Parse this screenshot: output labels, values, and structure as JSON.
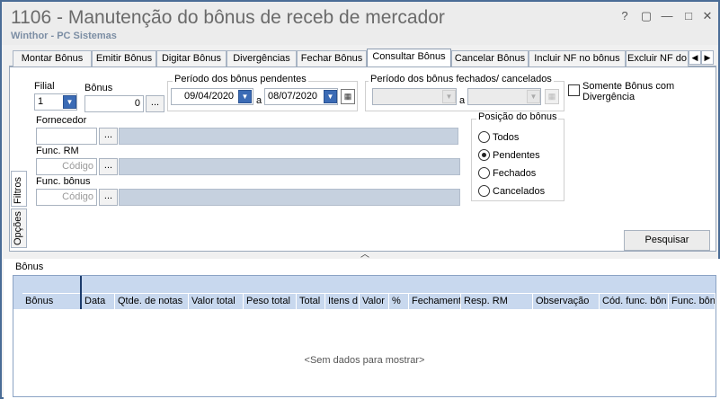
{
  "window": {
    "title": "1106 - Manutenção do bônus de receb de mercador",
    "subtitle": "Winthor - PC Sistemas",
    "controls": {
      "help": "?",
      "restore": "▢",
      "minimize": "—",
      "maximize": "□",
      "close": "✕"
    }
  },
  "tabs": [
    {
      "label": "Montar Bônus"
    },
    {
      "label": "Emitir Bônus"
    },
    {
      "label": "Digitar Bônus"
    },
    {
      "label": "Divergências"
    },
    {
      "label": "Fechar Bônus"
    },
    {
      "label": "Consultar Bônus",
      "active": true
    },
    {
      "label": "Cancelar Bônus"
    },
    {
      "label": "Incluir NF no bônus"
    },
    {
      "label": "Excluir NF do"
    }
  ],
  "side_tabs": {
    "filters": "Filtros",
    "options": "Opções"
  },
  "filters": {
    "filial_label": "Filial",
    "filial_value": "1",
    "bonus_label": "Bônus",
    "bonus_value": "0",
    "pending_period_label": "Período dos bônus pendentes",
    "pending_from": "09/04/2020",
    "pending_to": "08/07/2020",
    "closed_period_label": "Período dos bônus fechados/ cancelados",
    "closed_from": "",
    "closed_to": "",
    "range_separator": "a",
    "only_divergence_label_line1": "Somente Bônus com",
    "only_divergence_label_line2": "Divergência",
    "supplier_label": "Fornecedor",
    "func_rm_label": "Func. RM",
    "func_rm_placeholder": "Código",
    "func_bonus_label": "Func. bônus",
    "func_bonus_placeholder": "Código",
    "dots": "..."
  },
  "position": {
    "title": "Posição do bônus",
    "options": [
      "Todos",
      "Pendentes",
      "Fechados",
      "Cancelados"
    ],
    "selected": "Pendentes"
  },
  "search_button": "Pesquisar",
  "grid": {
    "caption": "Bônus",
    "columns": [
      "Bônus",
      "Data",
      "Qtde. de notas",
      "Valor total",
      "Peso total",
      "Total",
      "Itens d",
      "Valor",
      "%",
      "Fechament",
      "Resp. RM",
      "Observação",
      "Cód. func. bôn",
      "Func. bôn"
    ],
    "empty_message": "<Sem dados para mostrar>"
  },
  "colors": {
    "accent": "#3b6bb5",
    "grid_header": "#c8d8ee",
    "window_border": "#4a6c96"
  }
}
